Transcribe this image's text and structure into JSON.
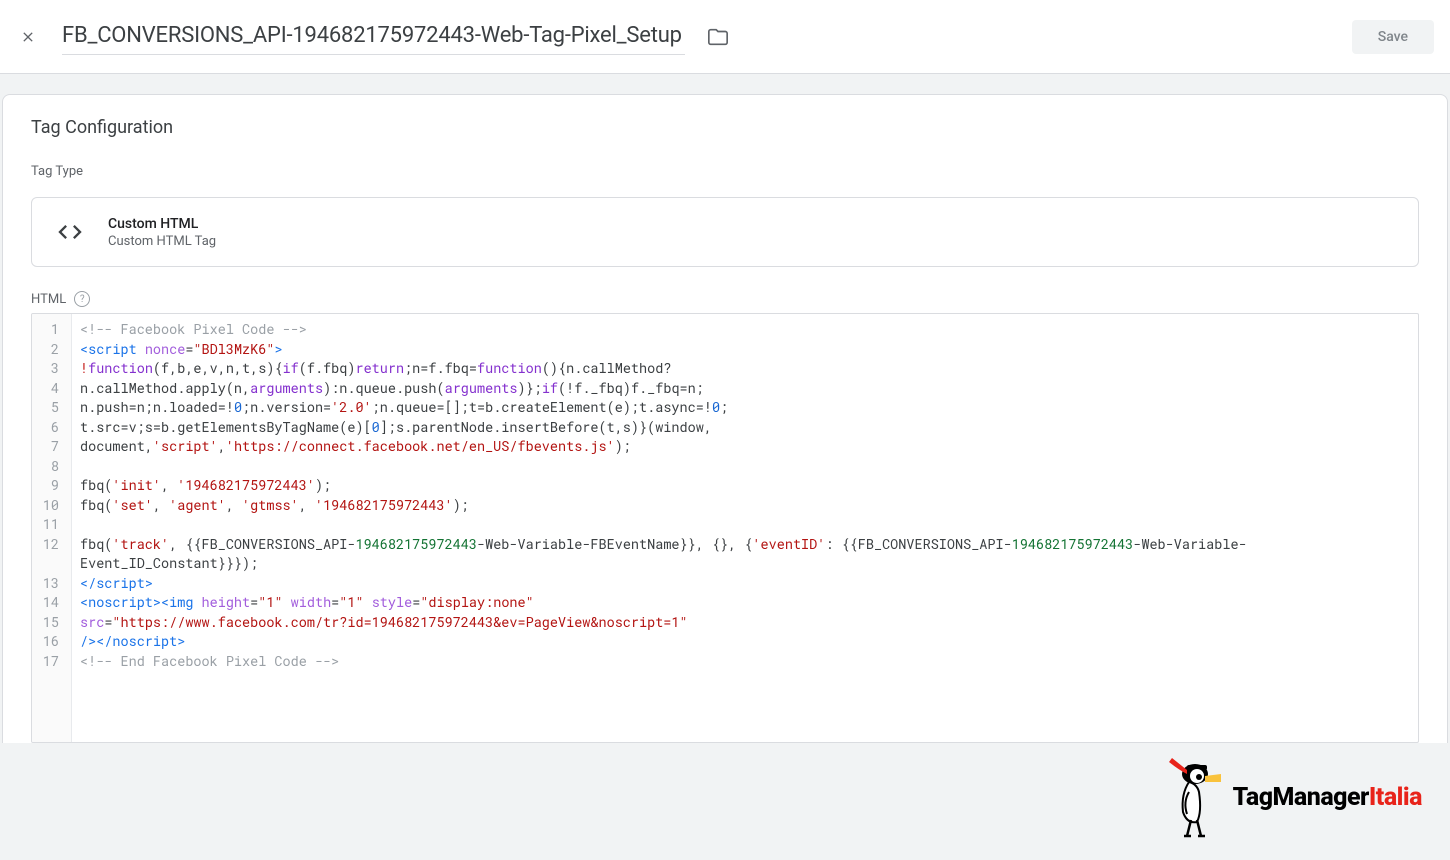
{
  "header": {
    "title": "FB_CONVERSIONS_API-194682175972443-Web-Tag-Pixel_Setup",
    "save_label": "Save"
  },
  "section": {
    "title": "Tag Configuration",
    "type_label": "Tag Type",
    "tag_title": "Custom HTML",
    "tag_sub": "Custom HTML Tag",
    "html_label": "HTML",
    "help_glyph": "?"
  },
  "code": {
    "line1_comment": "<!-- Facebook Pixel Code -->",
    "line2_open": "<script",
    "line2_attr": " nonce",
    "line2_eq": "=",
    "line2_val": "\"BDl3MzK6\"",
    "line2_close": ">",
    "line3_op": "!",
    "line3_fn": "function",
    "line3_args": "(f,b,e,v,n,t,s){",
    "line3_if": "if",
    "line3_body": "(f.fbq)",
    "line3_ret": "return",
    "line3_rest": ";n=f.fbq=",
    "line3_fn2": "function",
    "line3_rest2": "(){n.callMethod?",
    "line4_a": "n.callMethod.apply(n,",
    "line4_arg": "arguments",
    "line4_b": "):n.queue.push(",
    "line4_arg2": "arguments",
    "line4_c": ")};",
    "line4_if": "if",
    "line4_d": "(!f._fbq)f._fbq=n;",
    "line5_a": "n.push=n;n.loaded=!",
    "line5_n1": "0",
    "line5_b": ";n.version=",
    "line5_s1": "'2.0'",
    "line5_c": ";n.queue=[];t=b.createElement(e);t.async=!",
    "line5_n2": "0",
    "line5_d": ";",
    "line6_a": "t.src=v;s=b.getElementsByTagName(e)[",
    "line6_n": "0",
    "line6_b": "];s.parentNode.insertBefore(t,s)}(window,",
    "line7_a": "document,",
    "line7_s1": "'script'",
    "line7_b": ",",
    "line7_s2": "'https://connect.facebook.net/en_US/fbevents.js'",
    "line7_c": ");",
    "line9_a": "fbq(",
    "line9_s1": "'init'",
    "line9_b": ", ",
    "line9_s2": "'194682175972443'",
    "line9_c": ");",
    "line10_a": "fbq(",
    "line10_s1": "'set'",
    "line10_b": ", ",
    "line10_s2": "'agent'",
    "line10_c": ", ",
    "line10_s3": "'gtmss'",
    "line10_d": ", ",
    "line10_s4": "'194682175972443'",
    "line10_e": ");",
    "line12_a": "fbq(",
    "line12_s1": "'track'",
    "line12_b": ", {{FB_CONVERSIONS_API-",
    "line12_h1": "194682175972443",
    "line12_c": "-Web-Variable-FBEventName}}, {}, {",
    "line12_s2": "'eventID'",
    "line12_d": ": {{FB_CONVERSIONS_API-",
    "line12_h2": "194682175972443",
    "line12_e": "-Web-Variable-Event_ID_Constant}}});",
    "line13": "</scr",
    "line13b": "ipt>",
    "line14_a": "<noscript>",
    "line14_b": "<img",
    "line14_attr1": " height",
    "line14_eq": "=",
    "line14_v1": "\"1\"",
    "line14_attr2": " width",
    "line14_v2": "\"1\"",
    "line14_attr3": " style",
    "line14_v3": "\"display:none\"",
    "line15_attr": "src",
    "line15_v": "\"https://www.facebook.com/tr?id=194682175972443&ev=PageView&noscript=1\"",
    "line16_a": "/>",
    "line16_b": "</noscript>",
    "line17": "<!-- End Facebook Pixel Code -->"
  },
  "watermark": {
    "prefix": "TagManager",
    "suffix": "Italia"
  }
}
